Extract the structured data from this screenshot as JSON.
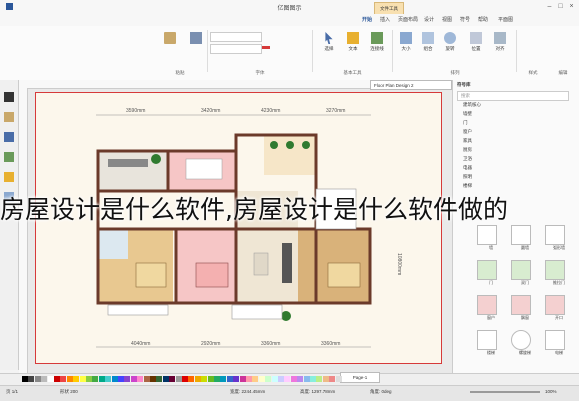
{
  "window": {
    "title": "亿图图示",
    "context_tab": "文件工具"
  },
  "tabs": [
    "开始",
    "插入",
    "页面布局",
    "设计",
    "视图",
    "符号",
    "帮助",
    "平面图"
  ],
  "ribbon": {
    "groups": [
      {
        "label": "粘贴"
      },
      {
        "label": "字体"
      },
      {
        "label": "基本工具"
      },
      {
        "label": "排列"
      },
      {
        "label": "样式"
      },
      {
        "label": "编辑"
      }
    ],
    "buttons": [
      "选择",
      "文本",
      "连接线",
      "大小",
      "组合",
      "旋转",
      "位置",
      "对齐"
    ]
  },
  "document": {
    "tab_label": "Floor Plan Design 2",
    "top_dims": [
      "3590mm",
      "3420mm",
      "4230mm",
      "3270mm"
    ],
    "bottom_dims": [
      "4040mm",
      "2920mm",
      "3360mm",
      "3360mm"
    ],
    "right_dim": "10800mm",
    "page_label": "Page-1"
  },
  "library": {
    "header": "符号库",
    "search_placeholder": "搜索",
    "categories": [
      "建筑核心",
      "墙壁",
      "门",
      "窗户",
      "家具",
      "厨房",
      "卫浴",
      "电器",
      "照明",
      "楼梯"
    ],
    "shapes": [
      "墙",
      "圆墙",
      "弧形墙",
      "门",
      "双门",
      "推拉门",
      "窗户",
      "飘窗",
      "开口",
      "楼梯",
      "螺旋梯",
      "电梯"
    ]
  },
  "status": {
    "page": "页 1/1",
    "shape_count": "形状 200",
    "width": "宽度: 2244.45mm",
    "height": "高度: 1297.78mm",
    "angle": "角度: 0deg",
    "zoom": "100%"
  },
  "caption": "房屋设计是什么软件,房屋设计是什么软件做的",
  "colors": {
    "accent": "#2b579a",
    "wall": "#6b3a2a",
    "frame": "#d63a3a",
    "bedroom_pink": "#f6c6c6",
    "floor_tan": "#e8c890",
    "floor_wood": "#d9b27a"
  }
}
